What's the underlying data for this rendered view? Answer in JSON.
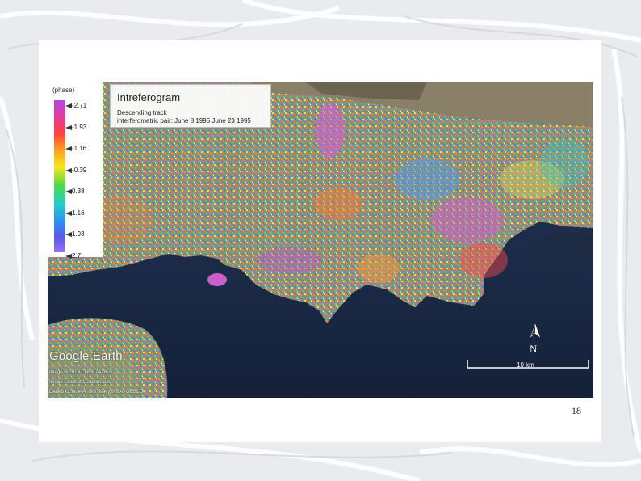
{
  "legend": {
    "unit": "(phase)",
    "labels": [
      "-2.71",
      "-1.93",
      "-1.16",
      "-0.39",
      "0.38",
      "1.16",
      "1.93",
      "2.7"
    ]
  },
  "title_box": {
    "title": "Intreferogram",
    "line1": "Descending track",
    "line2": "interferometric pair: June 8 1995 June 23 1995"
  },
  "map": {
    "logo": "Google Earth",
    "credit1": "Image © 2019 CNES / Airbus",
    "credit2": "Image Landsat / Copernicus",
    "credit3": "Data SIO, NOAA, U.S. Navy, NGA, GEBCO",
    "north_label": "N",
    "scale_label": "10 km"
  },
  "page": {
    "number": "18"
  },
  "colors": {
    "sea": "#1c2a44",
    "land": "#7c8a6a",
    "phase_purple": "#b04be0",
    "phase_red": "#ff4040",
    "phase_yellow": "#f6e81c",
    "phase_green": "#4fd84a",
    "phase_blue": "#2f8ff0"
  }
}
